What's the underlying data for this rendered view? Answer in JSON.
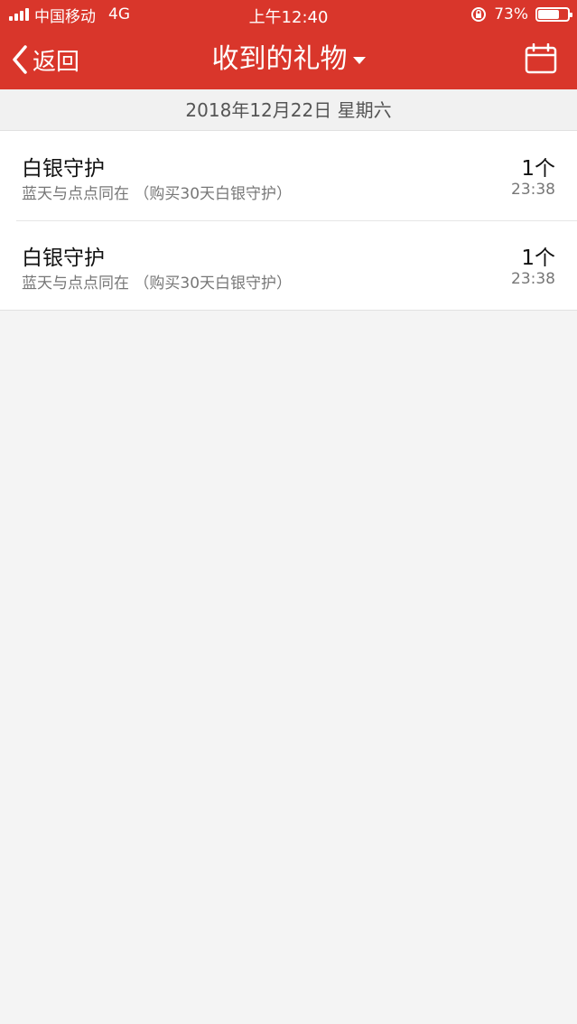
{
  "status_bar": {
    "carrier": "中国移动",
    "network": "4G",
    "time": "上午12:40",
    "battery": "73%",
    "battery_level": 0.73
  },
  "nav": {
    "back_label": "返回",
    "title": "收到的礼物"
  },
  "date_header": "2018年12月22日 星期六",
  "gifts": [
    {
      "name": "白银守护",
      "desc": "蓝天与点点同在 （购买30天白银守护）",
      "count": "1个",
      "time": "23:38"
    },
    {
      "name": "白银守护",
      "desc": "蓝天与点点同在 （购买30天白银守护）",
      "count": "1个",
      "time": "23:38"
    }
  ],
  "colors": {
    "brand_red": "#d9362b",
    "background": "#f4f4f4"
  }
}
